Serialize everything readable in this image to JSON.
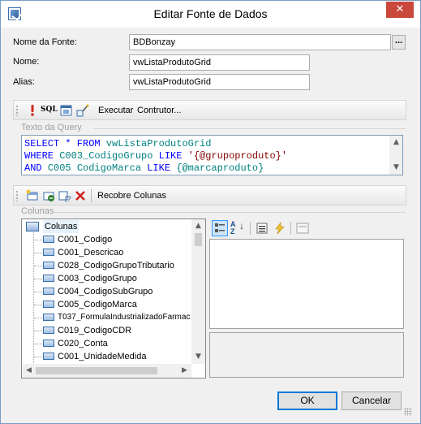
{
  "window": {
    "title": "Editar Fonte de Dados",
    "close_glyph": "✕",
    "accent_color": "#c9473b"
  },
  "form": {
    "source_name_label": "Nome da Fonte:",
    "source_name_value": "BDBonzay",
    "browse_label": "...",
    "name_label": "Nome:",
    "name_value": "vwListaProdutoGrid",
    "alias_label": "Alias:",
    "alias_value": "vwListaProdutoGrid"
  },
  "query_toolbar": {
    "run_icon": "exclamation-icon",
    "sql_label": "SQL",
    "execute_label": "Executar",
    "builder_label": "Contrutor..."
  },
  "query": {
    "group_title": "Texto da Query",
    "lines": [
      [
        "SELECT * FROM ",
        "vwListaProdutoGrid"
      ],
      [
        "WHERE ",
        "C003_CodigoGrupo",
        " LIKE ",
        "'{@grupoproduto}'"
      ],
      [
        "AND ",
        "C005 CodigoMarca",
        " LIKE ",
        "{@marcaproduto}"
      ]
    ]
  },
  "columns_toolbar": {
    "refresh_label": "Recobre Colunas"
  },
  "columns": {
    "group_title": "Colunas",
    "root": "Colunas",
    "items": [
      "C001_Codigo",
      "C001_Descricao",
      "C028_CodigoGrupoTributario",
      "C003_CodigoGrupo",
      "C004_CodigoSubGrupo",
      "C005_CodigoMarca",
      "T037_FormulaIndustrializadoFarmac",
      "C019_CodigoCDR",
      "C020_Conta",
      "C001_UnidadeMedida"
    ]
  },
  "property_toolbar": {
    "categorized_icon": "categorized-icon",
    "alphabetical_label": "AZ",
    "properties_icon": "properties-icon",
    "events_icon": "lightning-icon",
    "pages_icon": "property-pages-icon"
  },
  "buttons": {
    "ok_label": "OK",
    "cancel_label": "Cancelar"
  }
}
